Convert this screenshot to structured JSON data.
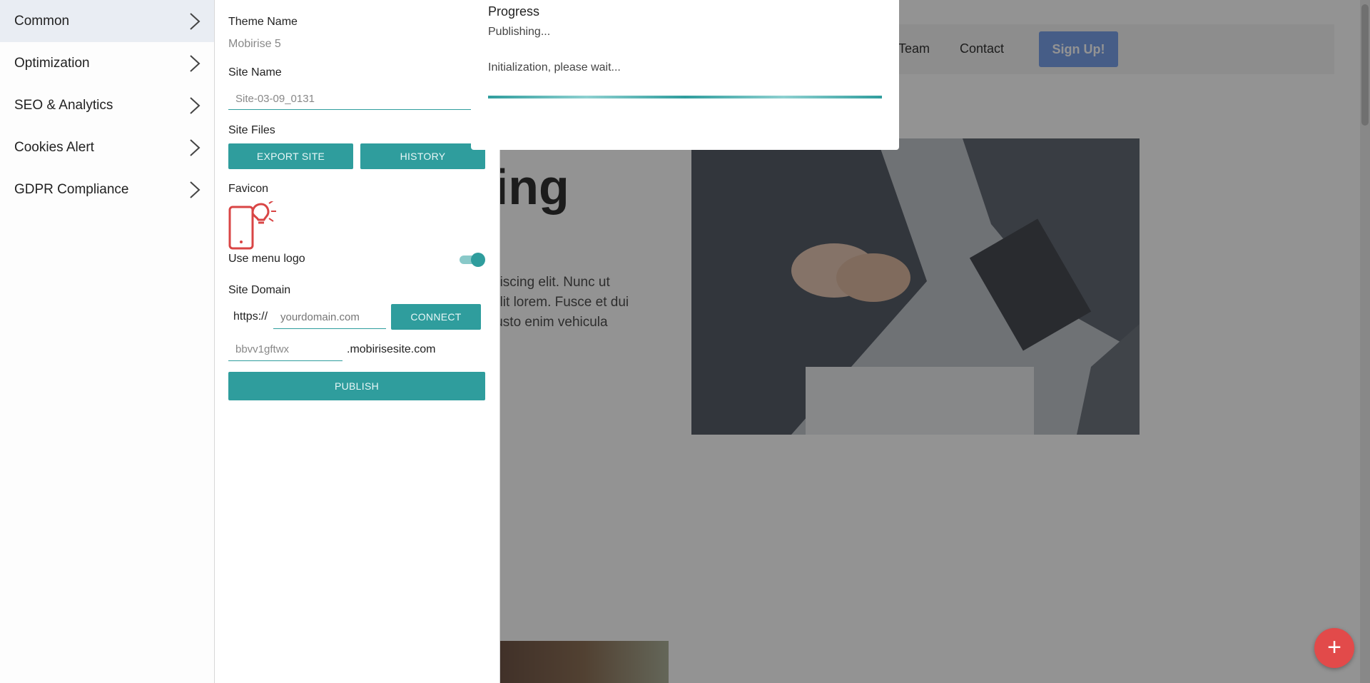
{
  "site": {
    "nav": {
      "team": "Team",
      "contact": "Contact",
      "signup": "Sign Up!"
    },
    "hero_title_fragment": "ding",
    "hero_text_lines": [
      "piscing elit. Nunc ut",
      "elit lorem. Fusce et dui",
      "justo enim vehicula"
    ],
    "fab_label": "+"
  },
  "sidebar": {
    "items": [
      {
        "label": "Common"
      },
      {
        "label": "Optimization"
      },
      {
        "label": "SEO & Analytics"
      },
      {
        "label": "Cookies Alert"
      },
      {
        "label": "GDPR Compliance"
      }
    ]
  },
  "panel": {
    "theme_name_label": "Theme Name",
    "theme_name_value": "Mobirise 5",
    "site_name_label": "Site Name",
    "site_name_value": "Site-03-09_0131",
    "site_files_label": "Site Files",
    "export_button": "EXPORT SITE",
    "history_button": "HISTORY",
    "favicon_label": "Favicon",
    "use_menu_logo_label": "Use menu logo",
    "use_menu_logo_on": true,
    "site_domain_label": "Site Domain",
    "protocol_prefix": "https://",
    "domain_placeholder": "yourdomain.com",
    "connect_button": "CONNECT",
    "subdomain_value": "bbvv1gftwx",
    "subdomain_suffix": ".mobirisesite.com",
    "publish_button": "PUBLISH"
  },
  "modal": {
    "title": "Progress",
    "status": "Publishing...",
    "message": "Initialization, please wait...",
    "progress_percent": 100
  },
  "colors": {
    "accent": "#2f9d9d",
    "signup": "#6592e6",
    "fab": "#e24a4a",
    "favicon": "#d94545"
  }
}
